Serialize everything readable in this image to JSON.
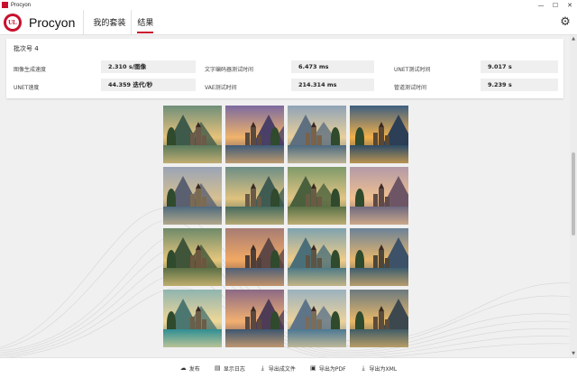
{
  "window": {
    "title": "Procyon",
    "buttons": [
      "—",
      "☐",
      "✕"
    ]
  },
  "app": {
    "name": "Procyon",
    "logo_text": "UL"
  },
  "nav": {
    "tabs": [
      {
        "label": "我的套装",
        "active": false
      },
      {
        "label": "结果",
        "active": true
      }
    ]
  },
  "stats": {
    "batch_label": "批次号 4",
    "items": [
      {
        "label": "图像生成速度",
        "value": "2.310 s/图像"
      },
      {
        "label": "文字编码器测试时间",
        "value": "6.473 ms"
      },
      {
        "label": "UNET测试时间",
        "value": "9.017 s"
      },
      {
        "label": "UNET速度",
        "value": "44.359 迭代/秒"
      },
      {
        "label": "VAE测试时间",
        "value": "214.314 ms"
      },
      {
        "label": "管道测试时间",
        "value": "9.239 s"
      }
    ]
  },
  "images": [
    {
      "sky": "#6f8f7a",
      "mtn": "#3e5a4a",
      "water": "#5a7a5c",
      "castle": "#6b5a48",
      "accent": "#e8c27a"
    },
    {
      "sky": "#7c6aa0",
      "mtn": "#4a3f66",
      "water": "#3e5b78",
      "castle": "#5a4a3e",
      "accent": "#f0b36a"
    },
    {
      "sky": "#8fa3b8",
      "mtn": "#5e6f80",
      "water": "#4c6a80",
      "castle": "#7a6248",
      "accent": "#e9cf9a"
    },
    {
      "sky": "#3e5f80",
      "mtn": "#2c3f56",
      "water": "#2e4c66",
      "castle": "#5a4634",
      "accent": "#f2b04a"
    },
    {
      "sky": "#9aa4b6",
      "mtn": "#5a6070",
      "water": "#4f6b7e",
      "castle": "#7b6a52",
      "accent": "#d8c090"
    },
    {
      "sky": "#6d8e86",
      "mtn": "#3f5b52",
      "water": "#456a5e",
      "castle": "#6a5a48",
      "accent": "#e0c27e"
    },
    {
      "sky": "#7f9a6a",
      "mtn": "#4a603c",
      "water": "#5a7248",
      "castle": "#6b5a44",
      "accent": "#e2c584"
    },
    {
      "sky": "#b39aa8",
      "mtn": "#6e5566",
      "water": "#6e6a80",
      "castle": "#5e4a48",
      "accent": "#f0c08e"
    },
    {
      "sky": "#6f8a6a",
      "mtn": "#3f5438",
      "water": "#5b6f46",
      "castle": "#6a573e",
      "accent": "#e6c77c"
    },
    {
      "sky": "#a67c74",
      "mtn": "#5e4744",
      "water": "#4e6078",
      "castle": "#4e3f38",
      "accent": "#f2a864"
    },
    {
      "sky": "#7ea3b0",
      "mtn": "#4b6f78",
      "water": "#4e7a86",
      "castle": "#5e5444",
      "accent": "#f0cc88"
    },
    {
      "sky": "#6b8298",
      "mtn": "#3d5268",
      "water": "#3e5e6e",
      "castle": "#4e4638",
      "accent": "#e8b66c"
    },
    {
      "sky": "#8fb4b0",
      "mtn": "#4c7670",
      "water": "#2f8f94",
      "castle": "#6a5e48",
      "accent": "#f0d898"
    },
    {
      "sky": "#8c6a86",
      "mtn": "#4e3c56",
      "water": "#3c5670",
      "castle": "#5a4840",
      "accent": "#f2b070"
    },
    {
      "sky": "#9bb2c0",
      "mtn": "#5e7488",
      "water": "#4c7894",
      "castle": "#7b6c58",
      "accent": "#ecd29a"
    },
    {
      "sky": "#6c7a80",
      "mtn": "#3c484e",
      "water": "#405c66",
      "castle": "#5c4c3c",
      "accent": "#e8b868"
    }
  ],
  "footer": {
    "buttons": [
      {
        "label": "发布",
        "icon": "cloud-upload-icon",
        "glyph": "☁"
      },
      {
        "label": "显示日志",
        "icon": "document-icon",
        "glyph": "▤"
      },
      {
        "label": "导出成文件",
        "icon": "download-icon",
        "glyph": "⤓"
      },
      {
        "label": "导出为PDF",
        "icon": "save-icon",
        "glyph": "▣"
      },
      {
        "label": "导出为XML",
        "icon": "download-icon",
        "glyph": "⤓"
      }
    ]
  },
  "colors": {
    "accent": "#c8102e"
  }
}
